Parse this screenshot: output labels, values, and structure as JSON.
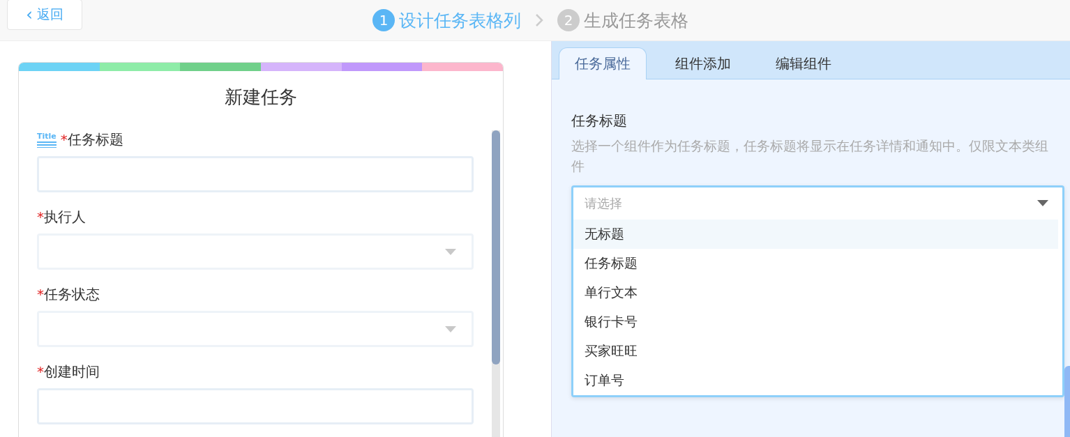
{
  "back_button": {
    "label": "返回",
    "icon": "‹"
  },
  "steps": [
    {
      "number": "1",
      "label": "设计任务表格列",
      "selected": true
    },
    {
      "number": "2",
      "label": "生成任务表格",
      "selected": false
    }
  ],
  "form_card": {
    "title": "新建任务",
    "fields": [
      {
        "label": "任务标题",
        "required_mark": "*",
        "kind": "text",
        "icon_text": "Title"
      },
      {
        "label": "执行人",
        "required_mark": "*",
        "kind": "select"
      },
      {
        "label": "任务状态",
        "required_mark": "*",
        "kind": "select"
      },
      {
        "label": "创建时间",
        "required_mark": "*",
        "kind": "text"
      }
    ]
  },
  "tabs": [
    {
      "label": "任务属性",
      "selected": true
    },
    {
      "label": "组件添加",
      "selected": false
    },
    {
      "label": "编辑组件",
      "selected": false
    }
  ],
  "task_title_setting": {
    "heading": "任务标题",
    "description": "选择一个组件作为任务标题，任务标题将显示在任务详情和通知中。仅限文本类组件",
    "select": {
      "placeholder": "请选择",
      "expanded": true,
      "options": [
        {
          "label": "无标题",
          "highlighted": true
        },
        {
          "label": "任务标题",
          "highlighted": false
        },
        {
          "label": "单行文本",
          "highlighted": false
        },
        {
          "label": "银行卡号",
          "highlighted": false
        },
        {
          "label": "买家旺旺",
          "highlighted": false
        },
        {
          "label": "订单号",
          "highlighted": false
        }
      ]
    }
  }
}
